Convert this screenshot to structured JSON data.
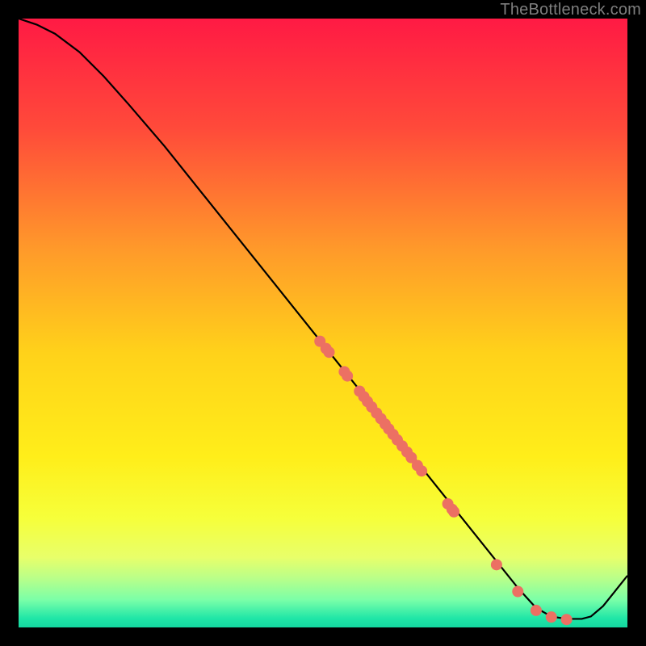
{
  "watermark": "TheBottleneck.com",
  "chart_data": {
    "type": "line",
    "xlim": [
      0,
      100
    ],
    "ylim": [
      0,
      100
    ],
    "xlabel": "",
    "ylabel": "",
    "title": "",
    "gradient_stops": [
      {
        "offset": 0,
        "color": "#ff1a44"
      },
      {
        "offset": 0.18,
        "color": "#ff4a3a"
      },
      {
        "offset": 0.38,
        "color": "#ff9a2a"
      },
      {
        "offset": 0.55,
        "color": "#ffd21a"
      },
      {
        "offset": 0.72,
        "color": "#ffee1a"
      },
      {
        "offset": 0.82,
        "color": "#f6ff3a"
      },
      {
        "offset": 0.885,
        "color": "#e8ff6a"
      },
      {
        "offset": 0.92,
        "color": "#b8ff8a"
      },
      {
        "offset": 0.955,
        "color": "#7affa8"
      },
      {
        "offset": 0.985,
        "color": "#20e6a7"
      },
      {
        "offset": 1.0,
        "color": "#14d7a0"
      }
    ],
    "curve": [
      {
        "x": 0.0,
        "y": 100.0
      },
      {
        "x": 3.0,
        "y": 99.0
      },
      {
        "x": 6.0,
        "y": 97.5
      },
      {
        "x": 10.0,
        "y": 94.5
      },
      {
        "x": 14.0,
        "y": 90.5
      },
      {
        "x": 18.0,
        "y": 86.0
      },
      {
        "x": 24.0,
        "y": 79.0
      },
      {
        "x": 30.0,
        "y": 71.5
      },
      {
        "x": 36.0,
        "y": 64.0
      },
      {
        "x": 42.0,
        "y": 56.5
      },
      {
        "x": 48.0,
        "y": 49.0
      },
      {
        "x": 54.0,
        "y": 41.5
      },
      {
        "x": 60.0,
        "y": 34.0
      },
      {
        "x": 66.0,
        "y": 26.5
      },
      {
        "x": 72.0,
        "y": 19.0
      },
      {
        "x": 78.0,
        "y": 11.5
      },
      {
        "x": 82.0,
        "y": 6.5
      },
      {
        "x": 85.0,
        "y": 3.2
      },
      {
        "x": 87.5,
        "y": 1.8
      },
      {
        "x": 90.0,
        "y": 1.4
      },
      {
        "x": 92.5,
        "y": 1.4
      },
      {
        "x": 94.0,
        "y": 1.8
      },
      {
        "x": 96.0,
        "y": 3.5
      },
      {
        "x": 98.0,
        "y": 6.0
      },
      {
        "x": 100.0,
        "y": 8.5
      }
    ],
    "data_points": [
      {
        "x": 49.5,
        "y": 47.0
      },
      {
        "x": 50.5,
        "y": 45.8
      },
      {
        "x": 51.0,
        "y": 45.2
      },
      {
        "x": 53.5,
        "y": 42.0
      },
      {
        "x": 54.0,
        "y": 41.3
      },
      {
        "x": 56.0,
        "y": 38.8
      },
      {
        "x": 56.7,
        "y": 37.9
      },
      {
        "x": 57.3,
        "y": 37.1
      },
      {
        "x": 58.0,
        "y": 36.2
      },
      {
        "x": 58.8,
        "y": 35.2
      },
      {
        "x": 59.5,
        "y": 34.3
      },
      {
        "x": 60.2,
        "y": 33.4
      },
      {
        "x": 60.8,
        "y": 32.6
      },
      {
        "x": 61.5,
        "y": 31.7
      },
      {
        "x": 62.2,
        "y": 30.8
      },
      {
        "x": 63.0,
        "y": 29.8
      },
      {
        "x": 63.8,
        "y": 28.8
      },
      {
        "x": 64.5,
        "y": 27.9
      },
      {
        "x": 65.5,
        "y": 26.6
      },
      {
        "x": 66.2,
        "y": 25.7
      },
      {
        "x": 70.5,
        "y": 20.3
      },
      {
        "x": 71.2,
        "y": 19.4
      },
      {
        "x": 71.5,
        "y": 19.0
      },
      {
        "x": 78.5,
        "y": 10.3
      },
      {
        "x": 82.0,
        "y": 5.9
      },
      {
        "x": 85.0,
        "y": 2.8
      },
      {
        "x": 87.5,
        "y": 1.7
      },
      {
        "x": 90.0,
        "y": 1.3
      }
    ],
    "point_color": "#ec7063",
    "line_color": "#000000"
  }
}
